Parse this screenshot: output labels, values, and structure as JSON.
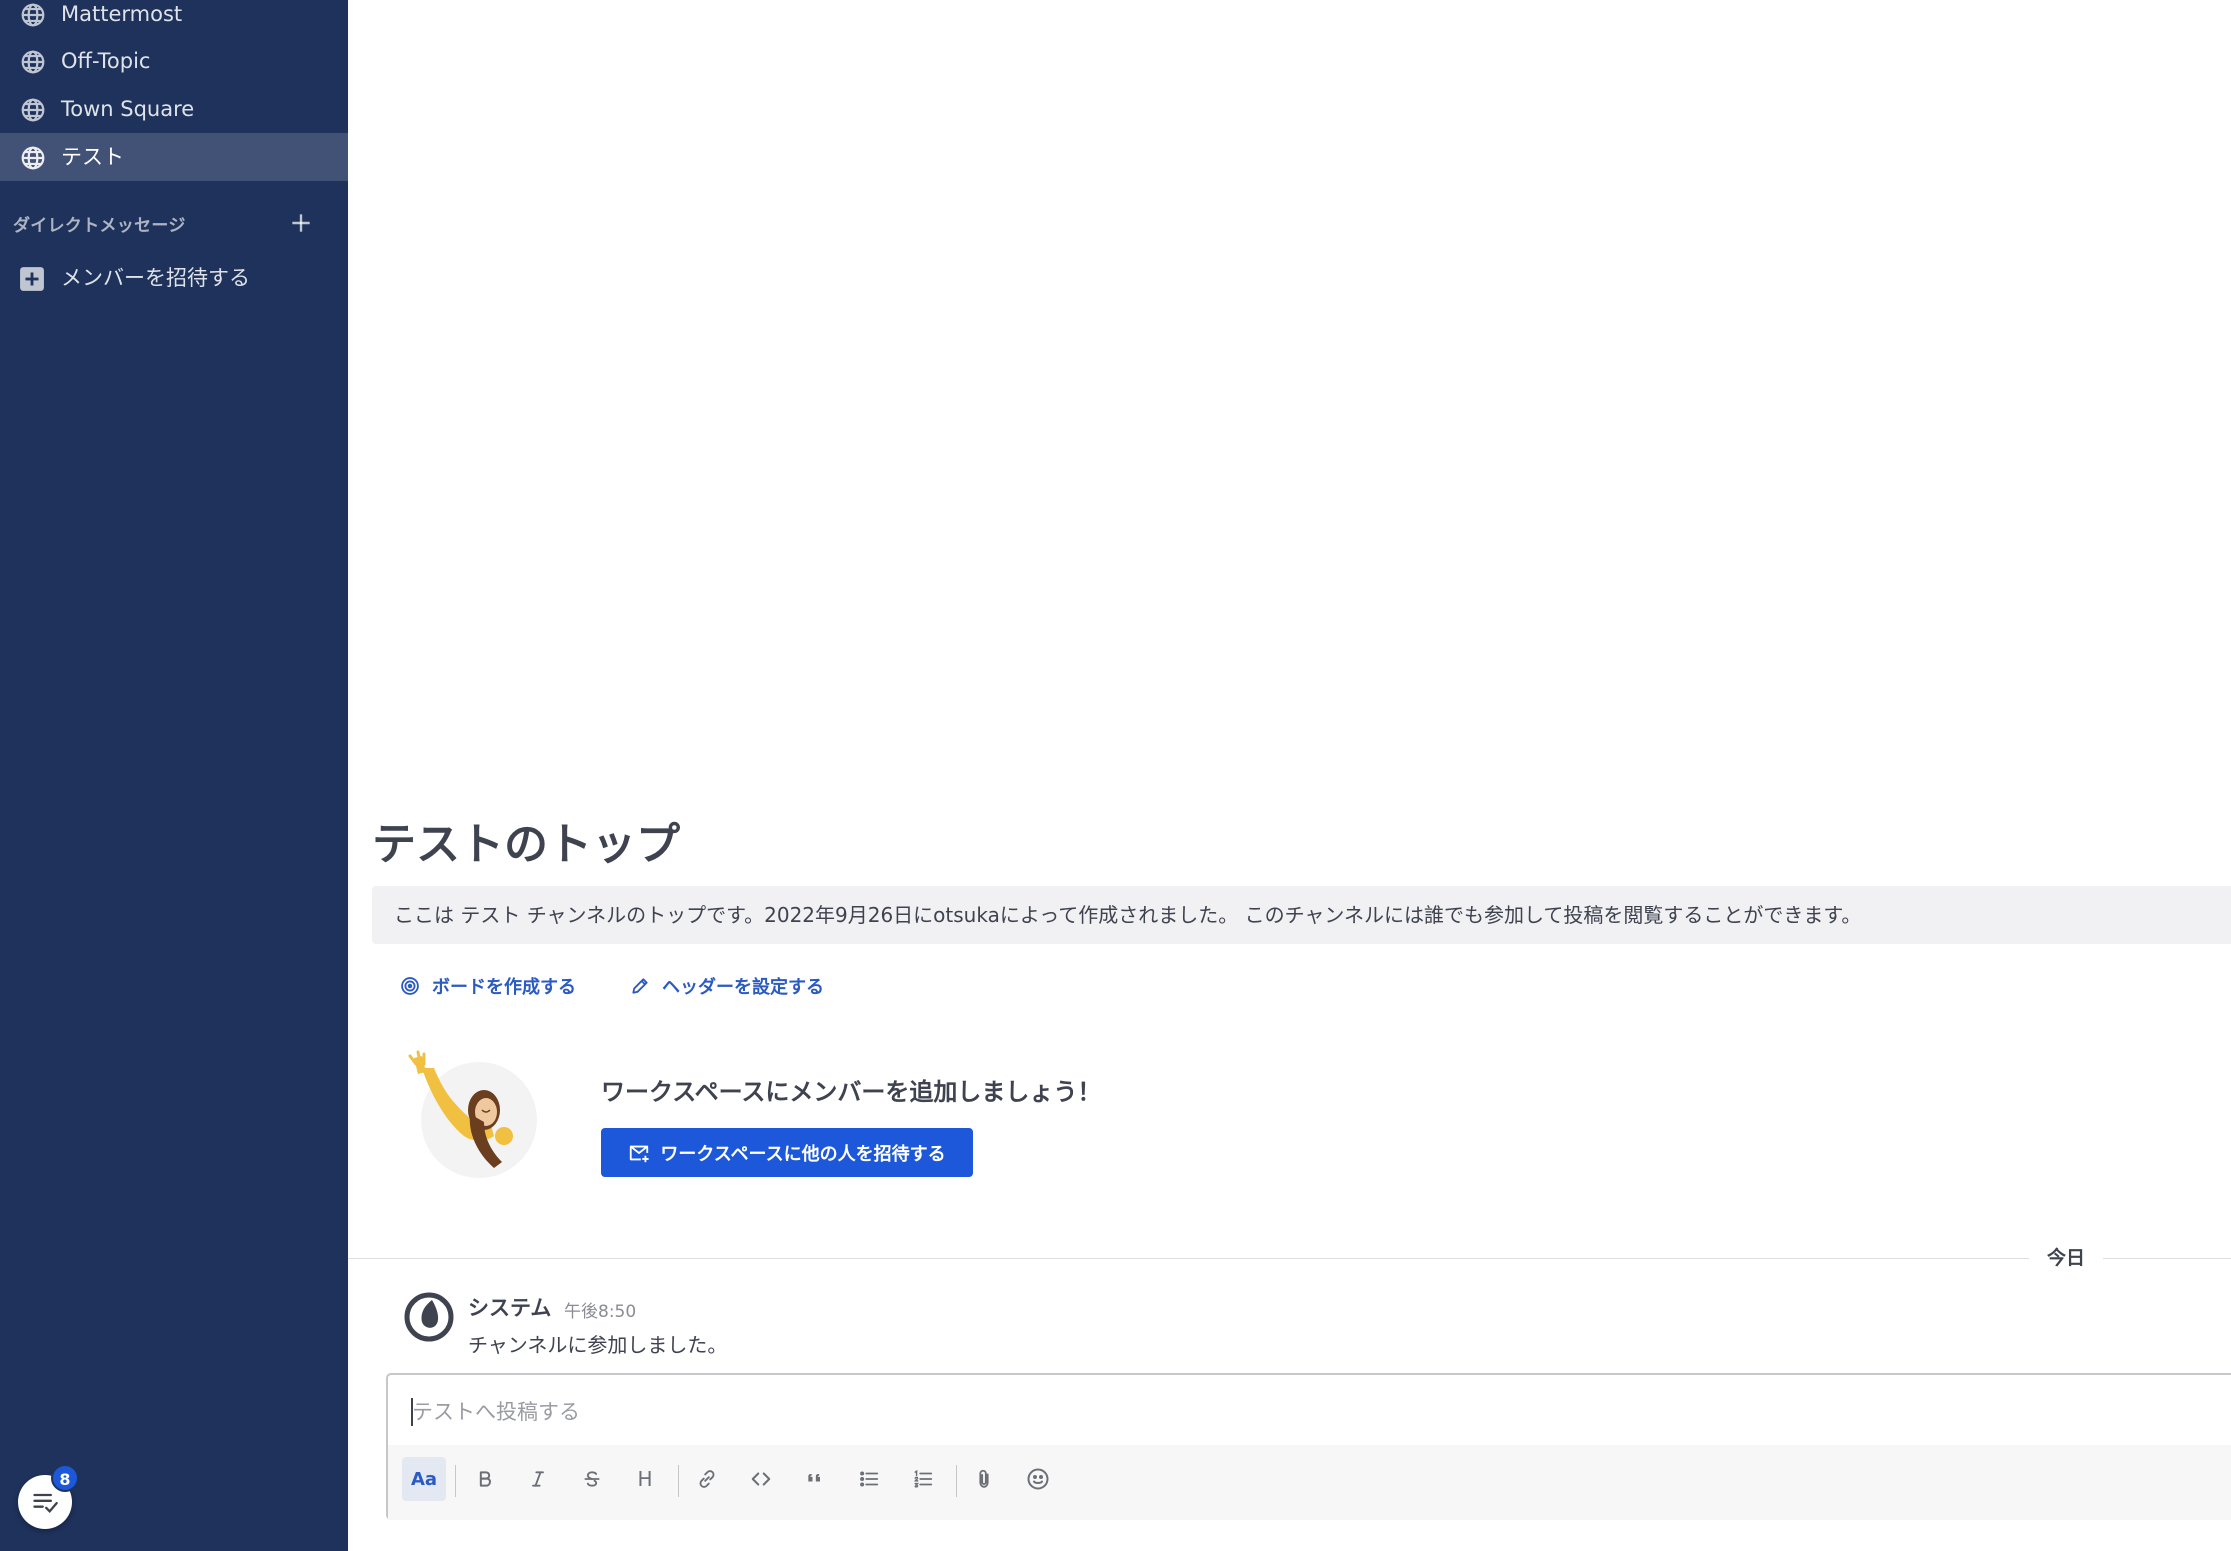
{
  "sidebar": {
    "channels": [
      {
        "label": "Mattermost",
        "icon": "globe-icon",
        "active": false
      },
      {
        "label": "Off-Topic",
        "icon": "globe-icon",
        "active": false
      },
      {
        "label": "Town Square",
        "icon": "globe-icon",
        "active": false
      },
      {
        "label": "テスト",
        "icon": "globe-icon",
        "active": true
      }
    ],
    "dm_section_label": "ダイレクトメッセージ",
    "invite_members_label": "メンバーを招待する",
    "checklist_badge_count": "8"
  },
  "main": {
    "intro_title": "テストのトップ",
    "intro_description": "ここは テスト チャンネルのトップです。2022年9月26日にotsukaによって作成されました。 このチャンネルには誰でも参加して投稿を閲覧することができます。",
    "actions": {
      "create_board": "ボードを作成する",
      "set_header": "ヘッダーを設定する"
    },
    "invite_heading": "ワークスペースにメンバーを追加しましょう！",
    "invite_button_label": "ワークスペースに他の人を招待する",
    "date_separator": "今日",
    "post": {
      "author": "システム",
      "time": "午後8:50",
      "message": "チャンネルに参加しました。"
    },
    "composer": {
      "placeholder": "テストへ投稿する",
      "value": "",
      "format_toggle_label": "Aa",
      "heading_label": "H"
    }
  },
  "colors": {
    "sidebar_bg": "#1e325c",
    "accent": "#1c58d9",
    "link": "#2b5bc1",
    "text": "#3f4350"
  }
}
